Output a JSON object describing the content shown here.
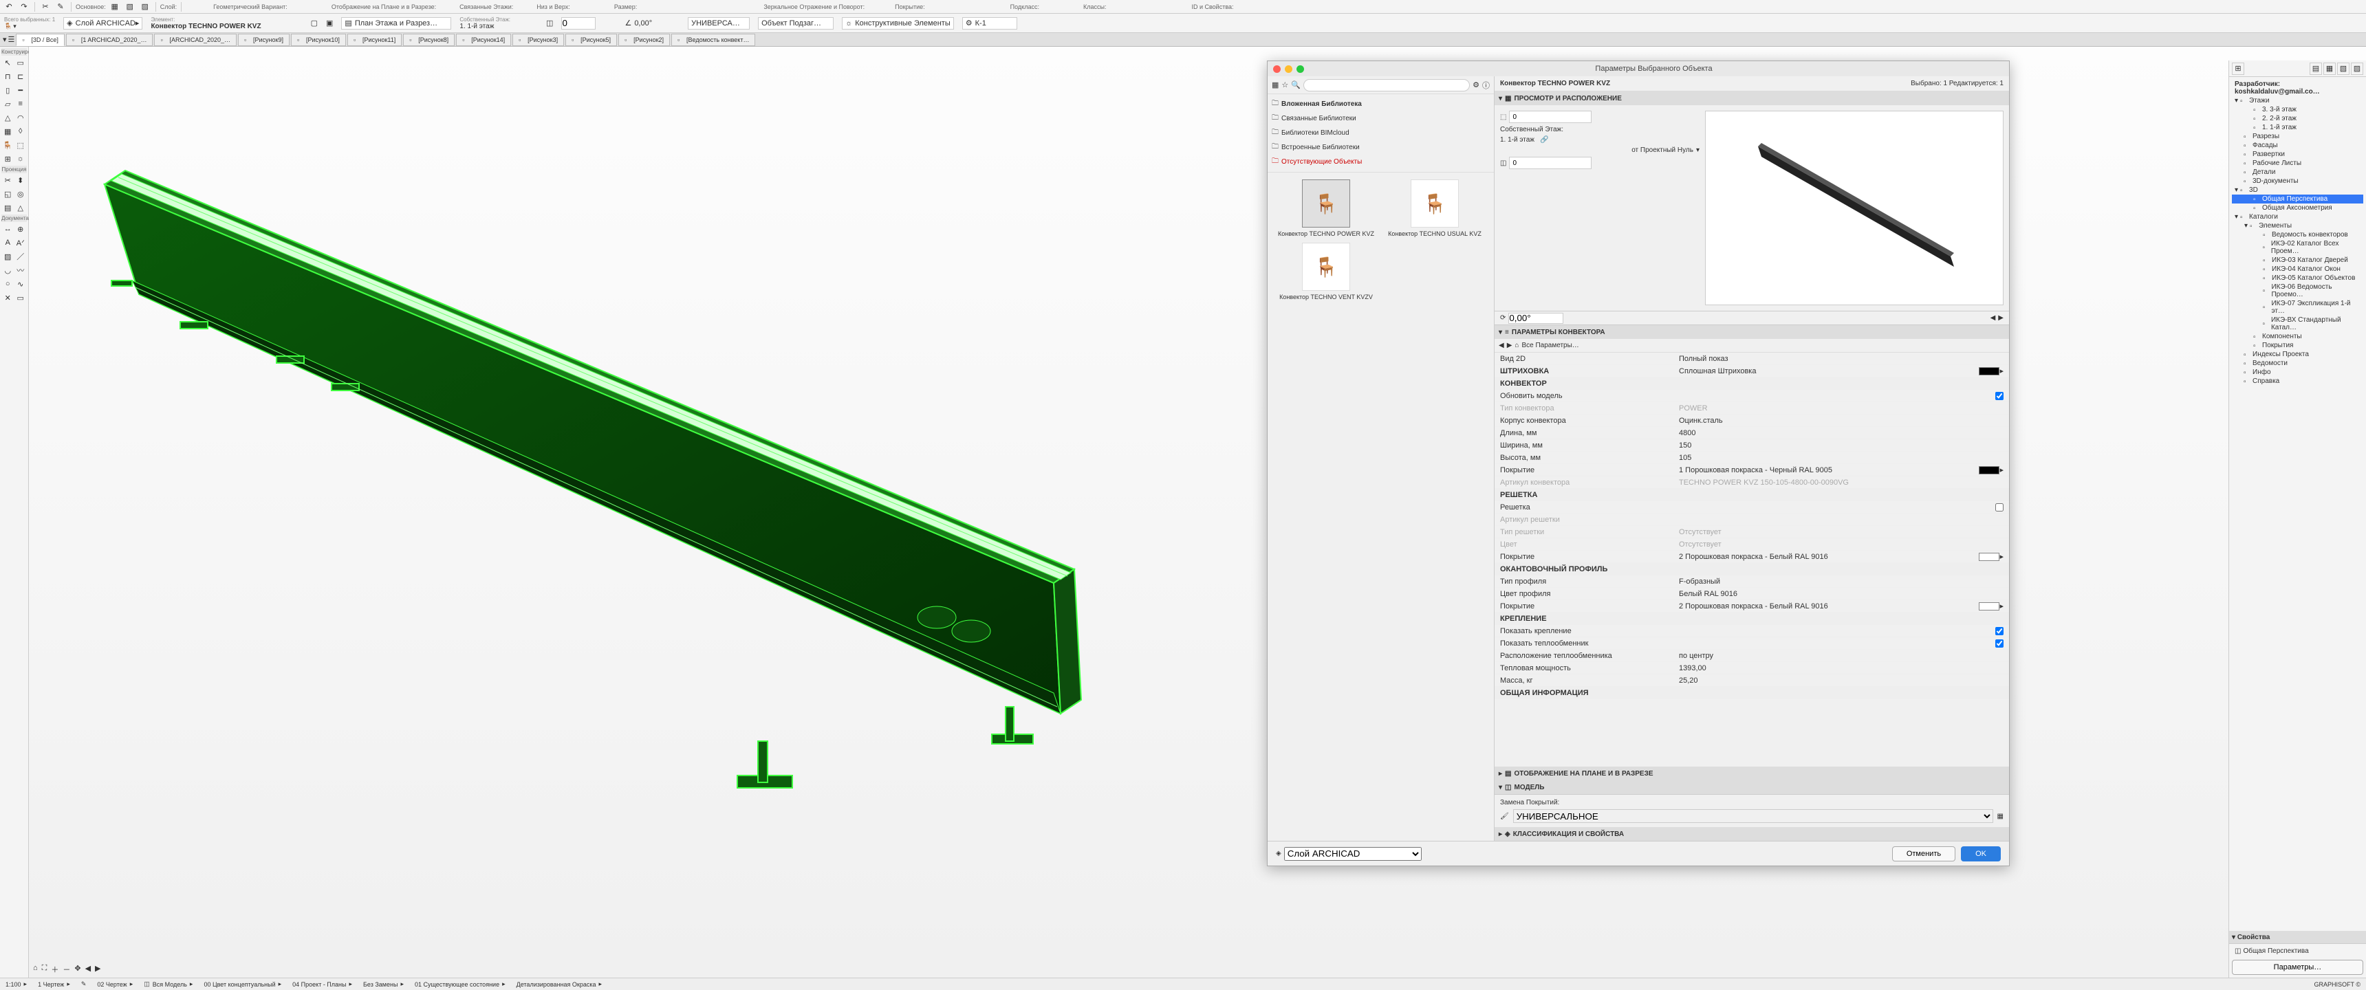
{
  "toolbar": {
    "labels": {
      "osnovnoe": "Основное:",
      "sloy": "Слой:",
      "geom_variant": "Геометрический Вариант:",
      "otobrazhenie": "Отображение на Плане и в Разрезе:",
      "svyaz_etaji": "Связанные Этажи:",
      "niz_verkh": "Низ и Верх:",
      "razmer": "Размер:",
      "zerkalo": "Зеркальное Отражение и Поворот:",
      "pokrytie": "Покрытие:",
      "podklass": "Подкласс:",
      "klass": "Классы:",
      "id_svoystva": "ID и Свойства:"
    },
    "vsego_vyb": "Всего выбранных: 1",
    "layer_value": "Слой ARCHICAD",
    "element_label": "Элемент:",
    "element_value": "Конвектор TECHNO POWER KVZ",
    "sobstv_etaj_lbl": "Собственный Этаж:",
    "sobstv_etaj_val": "1. 1-й этаж",
    "angle_val": "0,00°",
    "pokrytie_val": "УНИВЕРСА…",
    "podklass_val": "Объект Подзаг…",
    "klass_val": "Конструктивные Элементы",
    "klass_id": "К-1",
    "plan_etaja": "План Этажа и Разрез…"
  },
  "tabs": [
    {
      "label": "[3D / Все]",
      "active": true
    },
    {
      "label": "[1 ARCHICAD_2020_…",
      "active": false
    },
    {
      "label": "[ARCHICAD_2020_…",
      "active": false
    },
    {
      "label": "[Рисунок9]",
      "active": false
    },
    {
      "label": "[Рисунок10]",
      "active": false
    },
    {
      "label": "[Рисунок11]",
      "active": false
    },
    {
      "label": "[Рисунок8]",
      "active": false
    },
    {
      "label": "[Рисунок14]",
      "active": false
    },
    {
      "label": "[Рисунок3]",
      "active": false
    },
    {
      "label": "[Рисунок5]",
      "active": false
    },
    {
      "label": "[Рисунок2]",
      "active": false
    },
    {
      "label": "[Ведомость конвект…",
      "active": false
    }
  ],
  "toolbox": {
    "sections": [
      "Конструиров…",
      "Проекция",
      "Документац…"
    ]
  },
  "dialog": {
    "title": "Параметры Выбранного Объекта",
    "header_left": "Конвектор TECHNO POWER KVZ",
    "header_right": "Выбрано: 1 Редактируется: 1",
    "libs": [
      {
        "label": "Вложенная Библиотека",
        "bold": true
      },
      {
        "label": "Связанные Библиотеки"
      },
      {
        "label": "Библиотеки BIMcloud"
      },
      {
        "label": "Встроенные Библиотеки"
      },
      {
        "label": "Отсутствующие Объекты",
        "red": true
      }
    ],
    "gallery": [
      {
        "label": "Конвектор TECHNO POWER KVZ",
        "selected": true
      },
      {
        "label": "Конвектор TECHNO USUAL KVZ"
      },
      {
        "label": "Конвектор TECHNO VENT KVZV"
      }
    ],
    "preview": {
      "section_title": "ПРОСМОТР И РАСПОЛОЖЕНИЕ",
      "sobstv_etaj": "Собственный Этаж:",
      "etaj_val": "1. 1-й этаж",
      "z1": "0",
      "z_below": "от Проектный Нуль",
      "z2": "0",
      "rot": "0,00°"
    },
    "param_section_title": "ПАРАМЕТРЫ КОНВЕКТОРА",
    "crumb": "Все Параметры…",
    "params": [
      {
        "k": "Вид 2D",
        "v": "Полный показ"
      },
      {
        "k": "ШТРИХОВКА",
        "v": "Сплошная Штриховка",
        "bold": true,
        "swatch": "#000"
      },
      {
        "k": "КОНВЕКТОР",
        "group": true
      },
      {
        "k": "Обновить модель",
        "v": "",
        "chk": true
      },
      {
        "k": "Тип конвектора",
        "v": "POWER",
        "dim": true
      },
      {
        "k": "Корпус конвектора",
        "v": "Оцинк.сталь"
      },
      {
        "k": "Длина, мм",
        "v": "4800"
      },
      {
        "k": "Ширина, мм",
        "v": "150"
      },
      {
        "k": "Высота, мм",
        "v": "105"
      },
      {
        "k": "Покрытие",
        "v": "1 Порошковая покраска - Черный RAL 9005",
        "swatch": "#000"
      },
      {
        "k": "Артикул конвектора",
        "v": "TECHNO POWER KVZ   150-105-4800-00-0090VG",
        "dim": true
      },
      {
        "k": "РЕШЕТКА",
        "group": true
      },
      {
        "k": "Решетка",
        "v": "",
        "chk": false
      },
      {
        "k": "Артикул решетки",
        "v": "",
        "dim": true
      },
      {
        "k": "Тип решетки",
        "v": "Отсутствует",
        "dim": true
      },
      {
        "k": "Цвет",
        "v": "Отсутствует",
        "dim": true
      },
      {
        "k": "Покрытие",
        "v": "2 Порошковая покраска - Белый RAL 9016",
        "swatch": "#fff"
      },
      {
        "k": "ОКАНТОВОЧНЫЙ ПРОФИЛЬ",
        "group": true
      },
      {
        "k": "Тип профиля",
        "v": "F-образный"
      },
      {
        "k": "Цвет профиля",
        "v": "Белый RAL 9016"
      },
      {
        "k": "Покрытие",
        "v": "2 Порошковая покраска - Белый RAL 9016",
        "swatch": "#fff"
      },
      {
        "k": "КРЕПЛЕНИЕ",
        "group": true
      },
      {
        "k": "Показать крепление",
        "v": "",
        "chk": true
      },
      {
        "k": "Показать теплообменник",
        "v": "",
        "chk": true
      },
      {
        "k": "Расположение теплообменника",
        "v": "по центру"
      },
      {
        "k": "Тепловая мощность",
        "v": "1393,00"
      },
      {
        "k": "Масса, кг",
        "v": "25,20"
      },
      {
        "k": "ОБЩАЯ ИНФОРМАЦИЯ",
        "group": true
      }
    ],
    "otobr": "ОТОБРАЖЕНИЕ НА ПЛАНЕ И В РАЗРЕЗЕ",
    "model": "МОДЕЛЬ",
    "zamena_lbl": "Замена Покрытий:",
    "zamena_val": "УНИВЕРСАЛЬНОЕ",
    "klass": "КЛАССИФИКАЦИЯ И СВОЙСТВА",
    "layer": "Слой ARCHICAD",
    "btn_cancel": "Отменить",
    "btn_ok": "OK"
  },
  "navigator": {
    "root": "Разработчик: koshkaldaluv@gmail.co…",
    "items": [
      {
        "l": "Этажи",
        "c": 0,
        "exp": true
      },
      {
        "l": "3. 3-й этаж",
        "c": 1
      },
      {
        "l": "2. 2-й этаж",
        "c": 1
      },
      {
        "l": "1. 1-й этаж",
        "c": 1
      },
      {
        "l": "Разрезы",
        "c": 0
      },
      {
        "l": "Фасады",
        "c": 0
      },
      {
        "l": "Развертки",
        "c": 0
      },
      {
        "l": "Рабочие Листы",
        "c": 0
      },
      {
        "l": "Детали",
        "c": 0
      },
      {
        "l": "3D-документы",
        "c": 0
      },
      {
        "l": "3D",
        "c": 0,
        "exp": true
      },
      {
        "l": "Общая Перспектива",
        "c": 1,
        "sel": true
      },
      {
        "l": "Общая Аксонометрия",
        "c": 1
      },
      {
        "l": "Каталоги",
        "c": 0,
        "exp": true
      },
      {
        "l": "Элементы",
        "c": 1,
        "exp": true
      },
      {
        "l": "Ведомость конвекторов",
        "c": 2
      },
      {
        "l": "ИКЭ-02 Каталог Всех Проем…",
        "c": 2
      },
      {
        "l": "ИКЭ-03 Каталог Дверей",
        "c": 2
      },
      {
        "l": "ИКЭ-04 Каталог Окон",
        "c": 2
      },
      {
        "l": "ИКЭ-05 Каталог Объектов",
        "c": 2
      },
      {
        "l": "ИКЭ-06 Ведомость Проемо…",
        "c": 2
      },
      {
        "l": "ИКЭ-07 Экспликация 1-й эт…",
        "c": 2
      },
      {
        "l": "ИКЭ-ВХ Стандартный Катал…",
        "c": 2
      },
      {
        "l": "Компоненты",
        "c": 1
      },
      {
        "l": "Покрытия",
        "c": 1
      },
      {
        "l": "Индексы Проекта",
        "c": 0
      },
      {
        "l": "Ведомости",
        "c": 0
      },
      {
        "l": "Инфо",
        "c": 0
      },
      {
        "l": "Справка",
        "c": 0
      }
    ],
    "props_hdr": "Свойства",
    "props_name": "Общая Перспектива",
    "props_btn": "Параметры…"
  },
  "statusbar": {
    "scale": "1:100",
    "zoom": "1 Чертеж",
    "zoom_label": "02 Чертеж",
    "whole": "Вся Модель",
    "color": "00 Цвет концептуальный",
    "proj": "04 Проект - Планы",
    "bez": "Без Замены",
    "sost": "01 Существующее состояние",
    "detal": "Детализированная Окраска",
    "brand": "GRAPHISOFT ©"
  }
}
